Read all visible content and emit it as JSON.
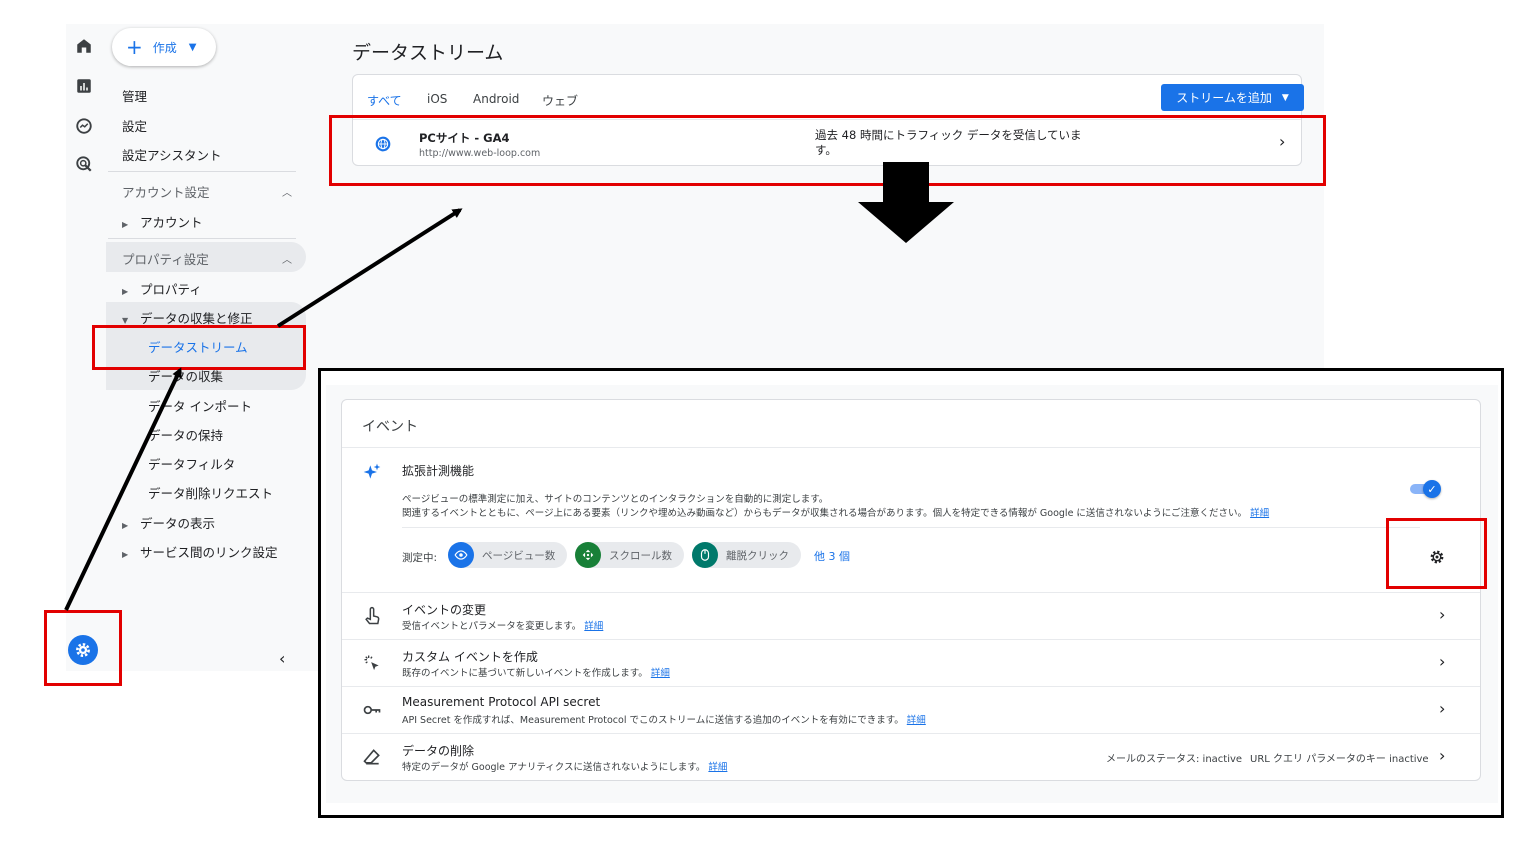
{
  "nav": {
    "create_label": "作成",
    "items": {
      "admin": "管理",
      "settings": "設定",
      "assistant": "設定アシスタント"
    },
    "account_section": "アカウント設定",
    "account": "アカウント",
    "property_section": "プロパティ設定",
    "property": "プロパティ",
    "data_collection": "データの収集と修正",
    "sub": {
      "streams": "データストリーム",
      "collection": "データの収集",
      "import": "データ インポート",
      "retention": "データの保持",
      "filters": "データフィルタ",
      "deletion": "データ削除リクエスト"
    },
    "display": "データの表示",
    "links": "サービス間のリンク設定"
  },
  "main": {
    "title": "データストリーム",
    "tabs": {
      "all": "すべて",
      "ios": "iOS",
      "android": "Android",
      "web": "ウェブ"
    },
    "add_stream_label": "ストリームを追加",
    "stream": {
      "name": "PCサイト - GA4",
      "url": "http://www.web-loop.com",
      "status": "過去 48 時間にトラフィック データを受信していま す。"
    }
  },
  "events": {
    "title": "イベント",
    "enhanced": {
      "title": "拡張計測機能",
      "desc1": "ページビューの標準測定に加え、サイトのコンテンツとのインタラクションを自動的に測定します。",
      "desc2": "関連するイベントとともに、ページ上にある要素（リンクや埋め込み動画など）からもデータが収集される場合があります。個人を特定できる情報が Google に送信されないようにご注意ください。",
      "link": "詳細",
      "measuring_label": "測定中:",
      "chips": {
        "pageview": "ページビュー数",
        "scroll": "スクロール数",
        "outbound": "離脱クリック"
      },
      "more": "他 3 個",
      "enabled": true
    },
    "modify": {
      "title": "イベントの変更",
      "desc": "受信イベントとパラメータを変更します。",
      "link": "詳細"
    },
    "custom": {
      "title": "カスタム イベントを作成",
      "desc": "既存のイベントに基づいて新しいイベントを作成します。",
      "link": "詳細"
    },
    "mp": {
      "title": "Measurement Protocol API secret",
      "desc": "API Secret を作成すれば、Measurement Protocol でこのストリームに送信する追加のイベントを有効にできます。",
      "link": "詳細"
    },
    "redact": {
      "title": "データの削除",
      "desc": "特定のデータが Google アナリティクスに送信されないようにします。",
      "link": "詳細",
      "email_status": "メールのステータス: inactive",
      "url_status": "URL クエリ パラメータのキー inactive"
    }
  },
  "colors": {
    "accent": "#1a73e8",
    "annotation_red": "#e20000",
    "chip_pageview": "#1a73e8",
    "chip_scroll": "#188038",
    "chip_outbound": "#00796b"
  },
  "icons": {
    "rail": [
      "home-icon",
      "reports-icon",
      "explore-icon",
      "advertising-icon"
    ],
    "admin": "gear-icon"
  }
}
